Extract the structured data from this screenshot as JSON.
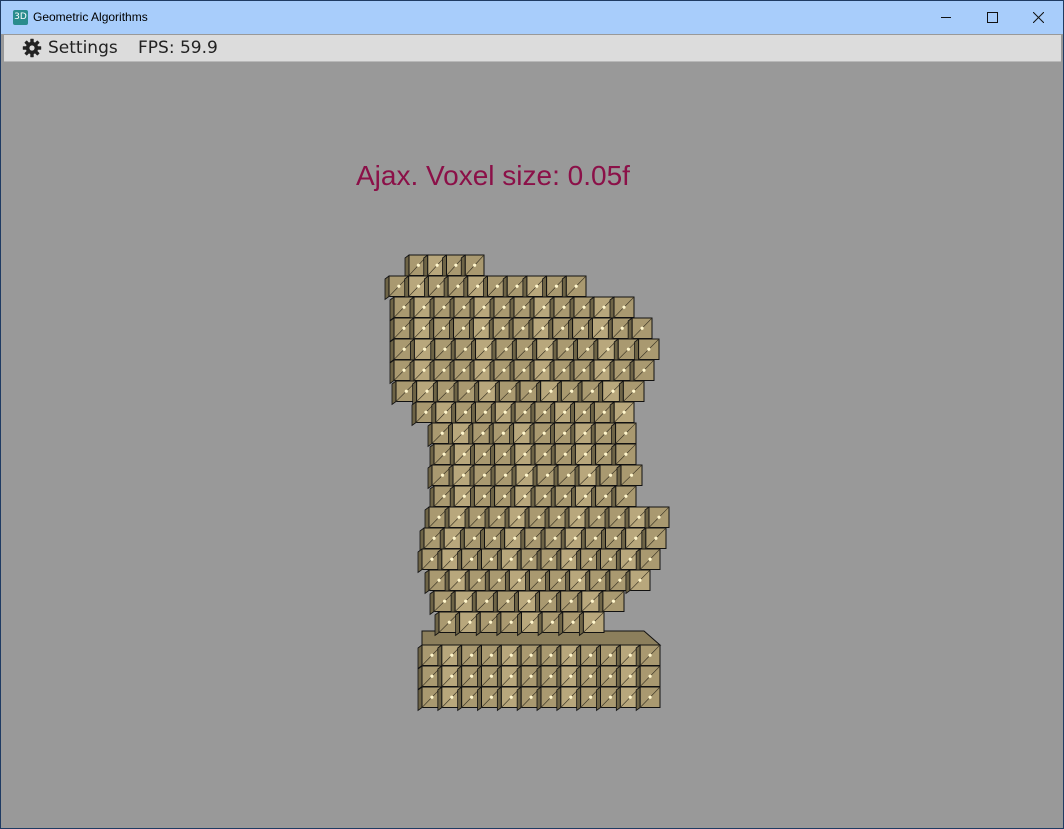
{
  "window": {
    "title": "Geometric Algorithms",
    "icon": "3D"
  },
  "menubar": {
    "settings_label": "Settings",
    "fps_text": "FPS: 59.9"
  },
  "viewport": {
    "caption": "Ajax. Voxel size: 0.05f",
    "caption_color": "#8b1048",
    "background_color": "#999999",
    "voxel_color": "#b4a378"
  }
}
